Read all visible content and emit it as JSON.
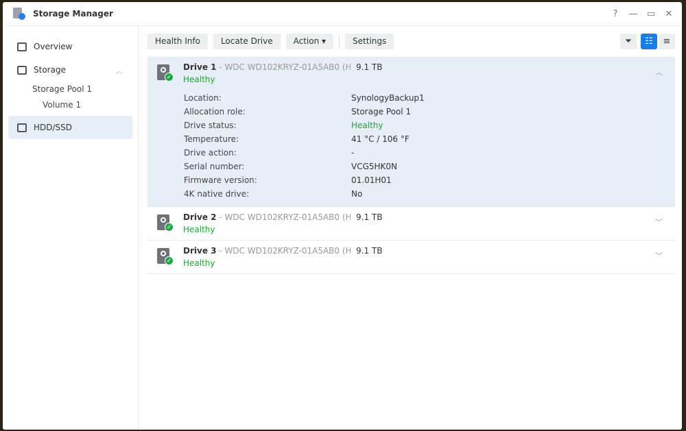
{
  "window": {
    "title": "Storage Manager",
    "controls": [
      "?",
      "—",
      "▭",
      "✕"
    ]
  },
  "sidebar": {
    "overview": "Overview",
    "storage": "Storage",
    "pool": "Storage Pool 1",
    "volume": "Volume 1",
    "hdd": "HDD/SSD"
  },
  "toolbar": {
    "health": "Health Info",
    "locate": "Locate Drive",
    "action": "Action ▾",
    "settings": "Settings"
  },
  "drives": [
    {
      "name": "Drive 1",
      "model": " - WDC WD102KRYZ-01A5AB0 (H...",
      "capacity": "9.1 TB",
      "status": "Healthy",
      "expanded": true,
      "details": [
        {
          "label": "Location:",
          "value": "SynologyBackup1"
        },
        {
          "label": "Allocation role:",
          "value": "Storage Pool 1"
        },
        {
          "label": "Drive status:",
          "value": "Healthy"
        },
        {
          "label": "Temperature:",
          "value": "41 °C / 106 °F"
        },
        {
          "label": "Drive action:",
          "value": "-"
        },
        {
          "label": "Serial number:",
          "value": "VCG5HK0N"
        },
        {
          "label": "Firmware version:",
          "value": "01.01H01"
        },
        {
          "label": "4K native drive:",
          "value": "No"
        }
      ]
    },
    {
      "name": "Drive 2",
      "model": " - WDC WD102KRYZ-01A5AB0 (H...",
      "capacity": "9.1 TB",
      "status": "Healthy"
    },
    {
      "name": "Drive 3",
      "model": " - WDC WD102KRYZ-01A5AB0 (H...",
      "capacity": "9.1 TB",
      "status": "Healthy"
    }
  ],
  "colors": {
    "accent": "#1a7de4",
    "healthy": "#25a038",
    "selected": "#e7eef7"
  }
}
